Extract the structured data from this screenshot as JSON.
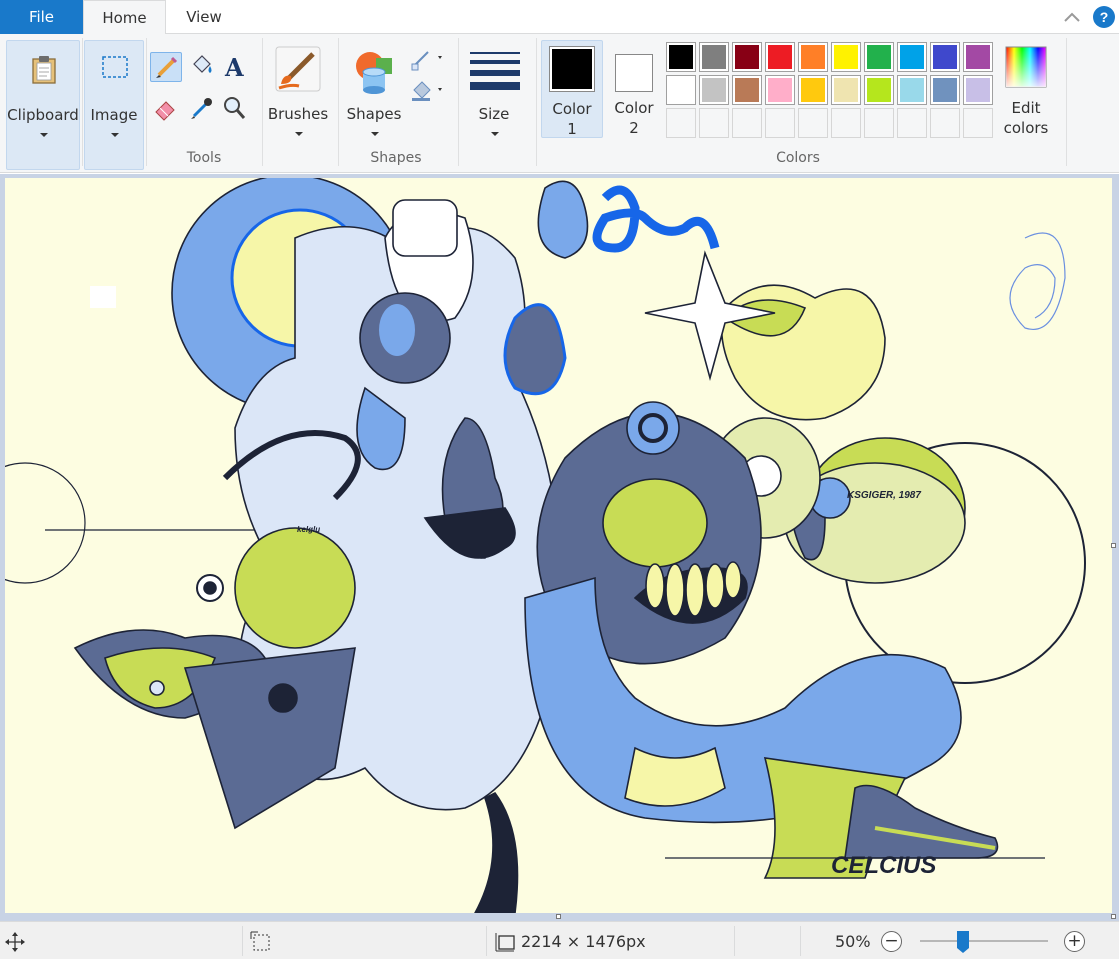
{
  "tabs": {
    "file": "File",
    "home": "Home",
    "view": "View"
  },
  "help_label": "?",
  "ribbon": {
    "clipboard": {
      "label": "Clipboard"
    },
    "image": {
      "label": "Image"
    },
    "tools": {
      "group_label": "Tools",
      "items": [
        "pencil-icon",
        "fill-icon",
        "text-icon",
        "eraser-icon",
        "color-picker-icon",
        "magnifier-icon"
      ]
    },
    "brushes": {
      "label": "Brushes"
    },
    "shapes": {
      "label": "Shapes",
      "group_label": "Shapes"
    },
    "size": {
      "label": "Size"
    },
    "color1": {
      "label_line1": "Color",
      "label_line2": "1",
      "value": "#000000"
    },
    "color2": {
      "label_line1": "Color",
      "label_line2": "2",
      "value": "#ffffff"
    },
    "colors": {
      "group_label": "Colors",
      "row1": [
        "#000000",
        "#7f7f7f",
        "#880015",
        "#ed1c24",
        "#ff7f27",
        "#fff200",
        "#22b14c",
        "#00a2e8",
        "#3f48cc",
        "#a349a4"
      ],
      "row2": [
        "#ffffff",
        "#c3c3c3",
        "#b97a57",
        "#ffaec9",
        "#ffc90e",
        "#efe4b0",
        "#b5e61d",
        "#99d9ea",
        "#7092be",
        "#c8bfe7"
      ],
      "row3_empty_count": 10
    },
    "edit_colors": {
      "label_line1": "Edit",
      "label_line2": "colors"
    }
  },
  "canvas": {
    "background": "#fdfde1",
    "texts": {
      "signature": "KSGIGER, 1987",
      "title": "CELCIUS",
      "scribble": "kelglu"
    },
    "palette": {
      "light_blue": "#7aa8ea",
      "pale_blue": "#dbe6f7",
      "slate": "#5b6b94",
      "navy": "#1d2336",
      "lime": "#c8dc55",
      "pale_yellow": "#f6f6a8",
      "cobalt": "#1766e8"
    }
  },
  "status": {
    "image_size": "2214 × 1476px",
    "zoom_label": "50%",
    "zoom_percent": 50
  }
}
